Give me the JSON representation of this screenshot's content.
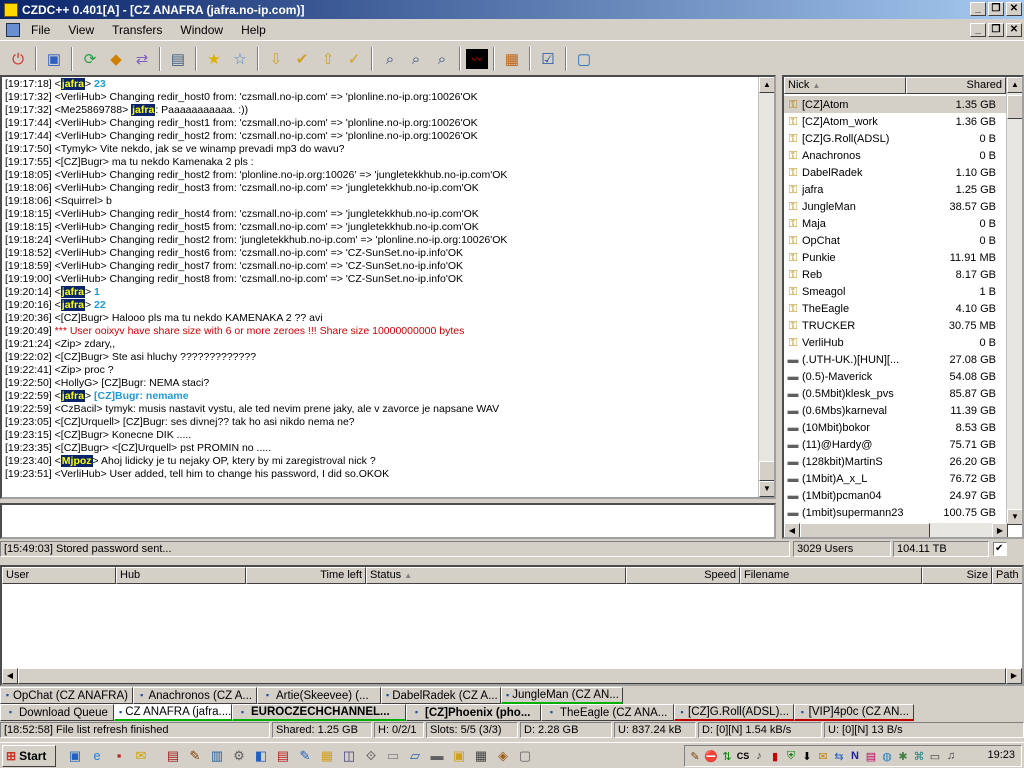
{
  "window": {
    "title": "CZDC++ 0.401[A] - [CZ ANAFRA (jafra.no-ip.com)]",
    "min": "_",
    "max": "❐",
    "close": "✕"
  },
  "menu": {
    "items": [
      "File",
      "View",
      "Transfers",
      "Window",
      "Help"
    ]
  },
  "toolbar": {
    "icons": [
      "power-icon",
      "hub-icon",
      "refresh-icon",
      "reconnect-icon",
      "follow-icon",
      "notepad-icon",
      "favorite-icon",
      "favorite-users-icon",
      "download-queue-icon",
      "finished-icon",
      "upload-queue-icon",
      "finished-uploads-icon",
      "search-icon",
      "adl-search-icon",
      "search-spy-icon",
      "network-stats-icon",
      "open-list-icon",
      "settings-icon",
      "help-icon"
    ]
  },
  "chat": {
    "lines": [
      {
        "ts": "[19:17:18]",
        "pre": "<",
        "nick": "jafra",
        "post": "> ",
        "text": "23",
        "style": "cyan"
      },
      {
        "ts": "[19:17:32]",
        "text": "<VerliHub> Changing redir_host0 from: 'czsmall.no-ip.com' => 'plonline.no-ip.org:10026'OK"
      },
      {
        "ts": "[19:17:32]",
        "pre": "<Me25869788> ",
        "nick": "jafra",
        "post": ": ",
        "text": "Paaaaaaaaaaa. :))"
      },
      {
        "ts": "[19:17:44]",
        "text": "<VerliHub> Changing redir_host1 from: 'czsmall.no-ip.com' => 'plonline.no-ip.org:10026'OK"
      },
      {
        "ts": "[19:17:44]",
        "text": "<VerliHub> Changing redir_host2 from: 'czsmall.no-ip.com' => 'plonline.no-ip.org:10026'OK"
      },
      {
        "ts": "[19:17:50]",
        "text": "<Tymyk> Vite nekdo, jak se ve winamp prevadi mp3 do wavu?"
      },
      {
        "ts": "[19:17:55]",
        "text": "<[CZ]Bugr> ma tu nekdo Kamenaka 2 pls :"
      },
      {
        "ts": "[19:18:05]",
        "text": "<VerliHub> Changing redir_host2 from: 'plonline.no-ip.org:10026' => 'jungletekkhub.no-ip.com'OK"
      },
      {
        "ts": "[19:18:06]",
        "text": "<VerliHub> Changing redir_host3 from: 'czsmall.no-ip.com' => 'jungletekkhub.no-ip.com'OK"
      },
      {
        "ts": "[19:18:06]",
        "text": "<Squirrel> b"
      },
      {
        "ts": "[19:18:15]",
        "text": "<VerliHub> Changing redir_host4 from: 'czsmall.no-ip.com' => 'jungletekkhub.no-ip.com'OK"
      },
      {
        "ts": "[19:18:15]",
        "text": "<VerliHub> Changing redir_host5 from: 'czsmall.no-ip.com' => 'jungletekkhub.no-ip.com'OK"
      },
      {
        "ts": "[19:18:24]",
        "text": "<VerliHub> Changing redir_host2 from: 'jungletekkhub.no-ip.com' => 'plonline.no-ip.org:10026'OK"
      },
      {
        "ts": "[19:18:52]",
        "text": "<VerliHub> Changing redir_host6 from: 'czsmall.no-ip.com' => 'CZ-SunSet.no-ip.info'OK"
      },
      {
        "ts": "[19:18:59]",
        "text": "<VerliHub> Changing redir_host7 from: 'czsmall.no-ip.com' => 'CZ-SunSet.no-ip.info'OK"
      },
      {
        "ts": "[19:19:00]",
        "text": "<VerliHub> Changing redir_host8 from: 'czsmall.no-ip.com' => 'CZ-SunSet.no-ip.info'OK"
      },
      {
        "ts": "[19:20:14]",
        "pre": "<",
        "nick": "jafra",
        "post": "> ",
        "text": "1",
        "style": "cyan"
      },
      {
        "ts": "[19:20:16]",
        "pre": "<",
        "nick": "jafra",
        "post": "> ",
        "text": "22",
        "style": "cyan"
      },
      {
        "ts": "[19:20:36]",
        "text": "<[CZ]Bugr> Halooo pls ma tu nekdo KAMENAKA 2 ?? avi"
      },
      {
        "ts": "[19:20:49]",
        "text": "*** User ooixyv have share size with 6 or more zeroes !!! Share size 10000000000 bytes",
        "style": "red"
      },
      {
        "ts": "[19:21:24]",
        "text": "<Zip> zdary,,"
      },
      {
        "ts": "[19:22:02]",
        "text": "<[CZ]Bugr> Ste asi hluchy ?????????????"
      },
      {
        "ts": "[19:22:41]",
        "text": "<Zip> proc ?"
      },
      {
        "ts": "[19:22:50]",
        "text": "<HollyG> [CZ]Bugr: NEMA staci?"
      },
      {
        "ts": "[19:22:59]",
        "pre": "<",
        "nick": "jafra",
        "post": "> ",
        "text": "[CZ]Bugr: nemame",
        "style": "cyan"
      },
      {
        "ts": "[19:22:59]",
        "text": "<CzBacil> tymyk: musis nastavit vystu, ale ted nevim prene jaky, ale v zavorce je napsane WAV"
      },
      {
        "ts": "[19:23:05]",
        "text": "<[CZ]Urquell> [CZ]Bugr: ses divnej?? tak ho asi nikdo nema ne?"
      },
      {
        "ts": "[19:23:15]",
        "text": "<[CZ]Bugr> Konecne DIK ....."
      },
      {
        "ts": "[19:23:35]",
        "text": "<[CZ]Bugr> <[CZ]Urquell> pst PROMIN no ....."
      },
      {
        "ts": "[19:23:40]",
        "pre": "<",
        "nick": "Mjpoz",
        "post": "> ",
        "text": "Ahoj lidicky je tu nejaky OP, ktery by mi zaregistroval nick ?"
      },
      {
        "ts": "[19:23:51]",
        "text": "<VerliHub> User added, tell him to change his password, I did so.OKOK"
      }
    ]
  },
  "users": {
    "col_nick": "Nick",
    "col_shared": "Shared",
    "sort_arrow": "▲",
    "rows": [
      {
        "nick": "[CZ]Atom",
        "shared": "1.35 GB",
        "icon": "key-icon"
      },
      {
        "nick": "[CZ]Atom_work",
        "shared": "1.36 GB",
        "icon": "key-icon"
      },
      {
        "nick": "[CZ]G.Roll(ADSL)",
        "shared": "0 B",
        "icon": "key-icon"
      },
      {
        "nick": "Anachronos",
        "shared": "0 B",
        "icon": "key-icon"
      },
      {
        "nick": "DabelRadek",
        "shared": "1.10 GB",
        "icon": "key-icon"
      },
      {
        "nick": "jafra",
        "shared": "1.25 GB",
        "icon": "key-icon"
      },
      {
        "nick": "JungleMan",
        "shared": "38.57 GB",
        "icon": "key-icon"
      },
      {
        "nick": "Maja",
        "shared": "0 B",
        "icon": "key-icon"
      },
      {
        "nick": "OpChat",
        "shared": "0 B",
        "icon": "key-icon"
      },
      {
        "nick": "Punkie",
        "shared": "11.91 MB",
        "icon": "key-icon"
      },
      {
        "nick": "Reb",
        "shared": "8.17 GB",
        "icon": "key-icon"
      },
      {
        "nick": "Smeagol",
        "shared": "1 B",
        "icon": "key-icon"
      },
      {
        "nick": "TheEagle",
        "shared": "4.10 GB",
        "icon": "key-icon"
      },
      {
        "nick": "TRUCKER",
        "shared": "30.75 MB",
        "icon": "key-icon"
      },
      {
        "nick": "VerliHub",
        "shared": "0 B",
        "icon": "key-icon"
      },
      {
        "nick": "(.UTH-UK.)[HUN][...",
        "shared": "27.08 GB",
        "icon": "user-icon"
      },
      {
        "nick": "(0.5)-Maverick",
        "shared": "54.08 GB",
        "icon": "user-icon"
      },
      {
        "nick": "(0.5Mbit)klesk_pvs",
        "shared": "85.87 GB",
        "icon": "user-icon"
      },
      {
        "nick": "(0.6Mbs)karneval",
        "shared": "11.39 GB",
        "icon": "user-icon"
      },
      {
        "nick": "(10Mbit)bokor",
        "shared": "8.53 GB",
        "icon": "user-icon"
      },
      {
        "nick": "(11)@Hardy@",
        "shared": "75.71 GB",
        "icon": "user-icon"
      },
      {
        "nick": "(128kbit)MartinS",
        "shared": "26.20 GB",
        "icon": "user-icon"
      },
      {
        "nick": "(1Mbit)A_x_L",
        "shared": "76.72 GB",
        "icon": "user-icon"
      },
      {
        "nick": "(1Mbit)pcman04",
        "shared": "24.97 GB",
        "icon": "user-icon"
      },
      {
        "nick": "(1mbit)supermann23",
        "shared": "100.75 GB",
        "icon": "user-icon"
      }
    ]
  },
  "status": {
    "message": "[15:49:03] Stored password sent...",
    "users": "3029 Users",
    "share": "104.11 TB",
    "checkbox": "✔"
  },
  "transfers": {
    "cols": {
      "user": "User",
      "hub": "Hub",
      "timeleft": "Time left",
      "status": "Status",
      "speed": "Speed",
      "filename": "Filename",
      "size": "Size",
      "path": "Path"
    },
    "status_arrow": "▲"
  },
  "tabs_row1": [
    "OpChat (CZ ANAFRA)",
    "Anachronos (CZ A...",
    "Artie(Skeevee) (...",
    "DabelRadek (CZ A...",
    "JungleMan (CZ AN..."
  ],
  "tabs_row2": [
    "Download Queue",
    "CZ ANAFRA (jafra....",
    "EUROCZECHCHANNEL...",
    "[CZ]Phoenix (pho...",
    "TheEagle (CZ ANA...",
    "[CZ]G.Roll(ADSL)...",
    "[VIP]4p0c (CZ AN..."
  ],
  "statusbar": {
    "message": "[18:52:58] File list refresh finished",
    "shared": "Shared: 1.25 GB",
    "hubs": "H: 0/2/1",
    "slots": "Slots: 5/5 (3/3)",
    "dl": "D: 2.28 GB",
    "ul": "U: 837.24 kB",
    "dspeed": "D: [0][N] 1.54 kB/s",
    "uspeed": "U: [0][N] 13 B/s"
  },
  "taskbar": {
    "start": "Start",
    "clock": "19:23"
  },
  "colors": {
    "titlebar": "#0a246a",
    "nick_highlight": "#0a246a",
    "nick_text": "#ffff00",
    "cyan": "#1f9bd7",
    "red": "#d00000"
  }
}
